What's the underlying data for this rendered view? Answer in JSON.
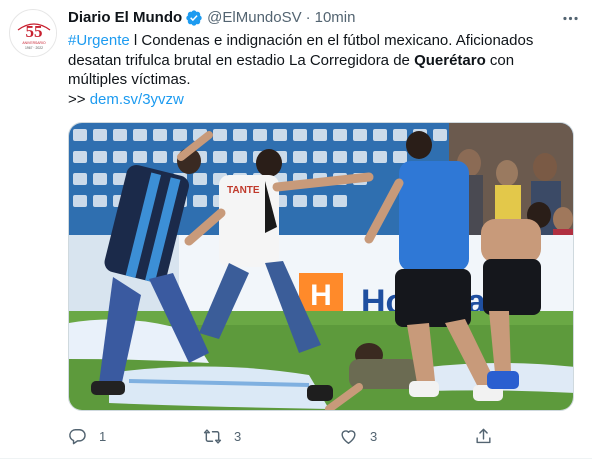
{
  "author": {
    "name": "Diario El Mundo",
    "handle": "@ElMundoSV",
    "separator": "·",
    "time": "10min",
    "avatar": {
      "badge_number": "55",
      "badge_caption": "ANIVERSARIO",
      "badge_years": "1967 · 2022",
      "accent_color": "#c8202f"
    }
  },
  "tweet": {
    "hashtag": "#Urgente",
    "line_1_rest": " l Condenas e indignación en el fútbol mexicano. Aficionados desatan trifulca brutal en estadio La Corregidora de ",
    "bold_word": "Querétaro",
    "line_end": " con múltiples víctimas.",
    "link_prefix": ">> ",
    "link": "dem.sv/3yvzw"
  },
  "media": {
    "jersey_text": "TANTE",
    "board_text": "Hospital"
  },
  "actions": {
    "reply_count": "1",
    "retweet_count": "3",
    "like_count": "3"
  },
  "colors": {
    "link_blue": "#1d9bf0",
    "verified_blue": "#1d9bf0",
    "secondary_text": "#536471"
  }
}
